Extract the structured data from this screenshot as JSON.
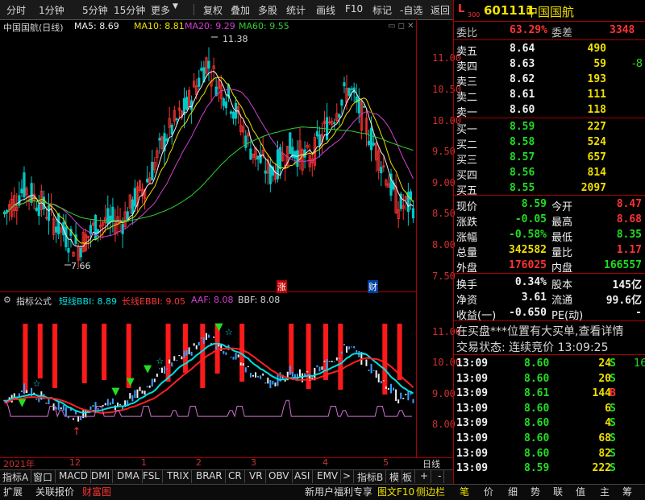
{
  "toolbar": {
    "left": [
      "分时",
      "1分钟",
      "5分钟",
      "15分钟",
      "更多"
    ],
    "right": [
      "复权",
      "叠加",
      "多股",
      "统计",
      "画线",
      "F10",
      "标记",
      "-自选",
      "返回"
    ]
  },
  "main_chart": {
    "title": "中国国航(日线)",
    "ma5": "MA5: 8.69",
    "ma10": "MA10: 8.81",
    "ma20": "MA20: 9.29",
    "ma60": "MA60: 9.55",
    "high_label": "11.38",
    "low_label": "7.66",
    "markers": [
      "涨",
      "财"
    ],
    "axis": [
      "11.00",
      "10.50",
      "10.00",
      "9.50",
      "9.00",
      "8.50",
      "8.00",
      "7.50"
    ],
    "colors": {
      "up": "#ff3333",
      "down": "#00c8c8",
      "ma5": "#f0f0f0",
      "ma10": "#f0e000",
      "ma20": "#d040d0",
      "ma60": "#30d030"
    }
  },
  "indicator": {
    "title": "指标公式",
    "bbi": "短线BBI: 8.89",
    "ebbi": "长线EBBI: 9.05",
    "aaf": "AAF: 8.08",
    "bbf": "BBF: 8.08",
    "axis": [
      "11.00",
      "10.00",
      "9.00",
      "8.00"
    ]
  },
  "timeline": {
    "labels": [
      "2021年",
      "12",
      "1",
      "2",
      "3",
      "4",
      "5"
    ],
    "period": "日线"
  },
  "tabs": [
    "指标A",
    "窗口",
    "MACD",
    "DMI",
    "DMA",
    "FSL",
    "TRIX",
    "BRAR",
    "CR",
    "VR",
    "OBV",
    "ASI",
    "EMV",
    ">",
    "指标B",
    "模",
    "板",
    "+",
    "-"
  ],
  "status": {
    "left": [
      "扩展",
      "关联报价",
      "财富图"
    ],
    "mid": [
      "新用户福利专享",
      "图文F10",
      "侧边栏"
    ],
    "right": [
      "笔",
      "价",
      "细",
      "势",
      "联",
      "值",
      "主",
      "筹"
    ]
  },
  "quote": {
    "prefix": "L",
    "sub": "300",
    "code": "601111",
    "name": "中国国航",
    "weibi_label": "委比",
    "weibi": "63.29%",
    "weicha_label": "委差",
    "weicha": "3348",
    "asks": [
      {
        "label": "卖五",
        "price": "8.64",
        "vol": "490",
        "chg": ""
      },
      {
        "label": "卖四",
        "price": "8.63",
        "vol": "59",
        "chg": "-8"
      },
      {
        "label": "卖三",
        "price": "8.62",
        "vol": "193",
        "chg": ""
      },
      {
        "label": "卖二",
        "price": "8.61",
        "vol": "111",
        "chg": ""
      },
      {
        "label": "卖一",
        "price": "8.60",
        "vol": "118",
        "chg": ""
      }
    ],
    "bids": [
      {
        "label": "买一",
        "price": "8.59",
        "vol": "227"
      },
      {
        "label": "买二",
        "price": "8.58",
        "vol": "524"
      },
      {
        "label": "买三",
        "price": "8.57",
        "vol": "657"
      },
      {
        "label": "买四",
        "price": "8.56",
        "vol": "814"
      },
      {
        "label": "买五",
        "price": "8.55",
        "vol": "2097"
      }
    ],
    "stats": [
      {
        "l1": "现价",
        "v1": "8.59",
        "l2": "今开",
        "v2": "8.47"
      },
      {
        "l1": "涨跌",
        "v1": "-0.05",
        "l2": "最高",
        "v2": "8.68"
      },
      {
        "l1": "涨幅",
        "v1": "-0.58%",
        "l2": "最低",
        "v2": "8.35"
      },
      {
        "l1": "总量",
        "v1": "342582",
        "l2": "量比",
        "v2": "1.17"
      },
      {
        "l1": "外盘",
        "v1": "176025",
        "l2": "内盘",
        "v2": "166557"
      }
    ],
    "stats2": [
      {
        "l1": "换手",
        "v1": "0.34%",
        "l2": "股本",
        "v2": "145亿"
      },
      {
        "l1": "净资",
        "v1": "3.61",
        "l2": "流通",
        "v2": "99.6亿"
      },
      {
        "l1": "收益(一)",
        "v1": "-0.650",
        "l2": "PE(动)",
        "v2": "-"
      }
    ],
    "notice": "在买盘***位置有大买单,查看详情",
    "trade_state": "交易状态: 连续竞价 13:09:25",
    "ticks": [
      {
        "t": "13:09",
        "p": "8.60",
        "v": "24",
        "s": "S"
      },
      {
        "t": "13:09",
        "p": "8.60",
        "v": "20",
        "s": "S"
      },
      {
        "t": "13:09",
        "p": "8.61",
        "v": "144",
        "s": "B"
      },
      {
        "t": "13:09",
        "p": "8.60",
        "v": "6",
        "s": "S"
      },
      {
        "t": "13:09",
        "p": "8.60",
        "v": "4",
        "s": "S"
      },
      {
        "t": "13:09",
        "p": "8.60",
        "v": "68",
        "s": "S"
      },
      {
        "t": "13:09",
        "p": "8.60",
        "v": "82",
        "s": "S"
      },
      {
        "t": "13:09",
        "p": "8.59",
        "v": "222",
        "s": "S"
      }
    ],
    "tick_tail": [
      "16",
      "",
      "",
      "",
      "",
      "",
      "",
      ""
    ]
  }
}
